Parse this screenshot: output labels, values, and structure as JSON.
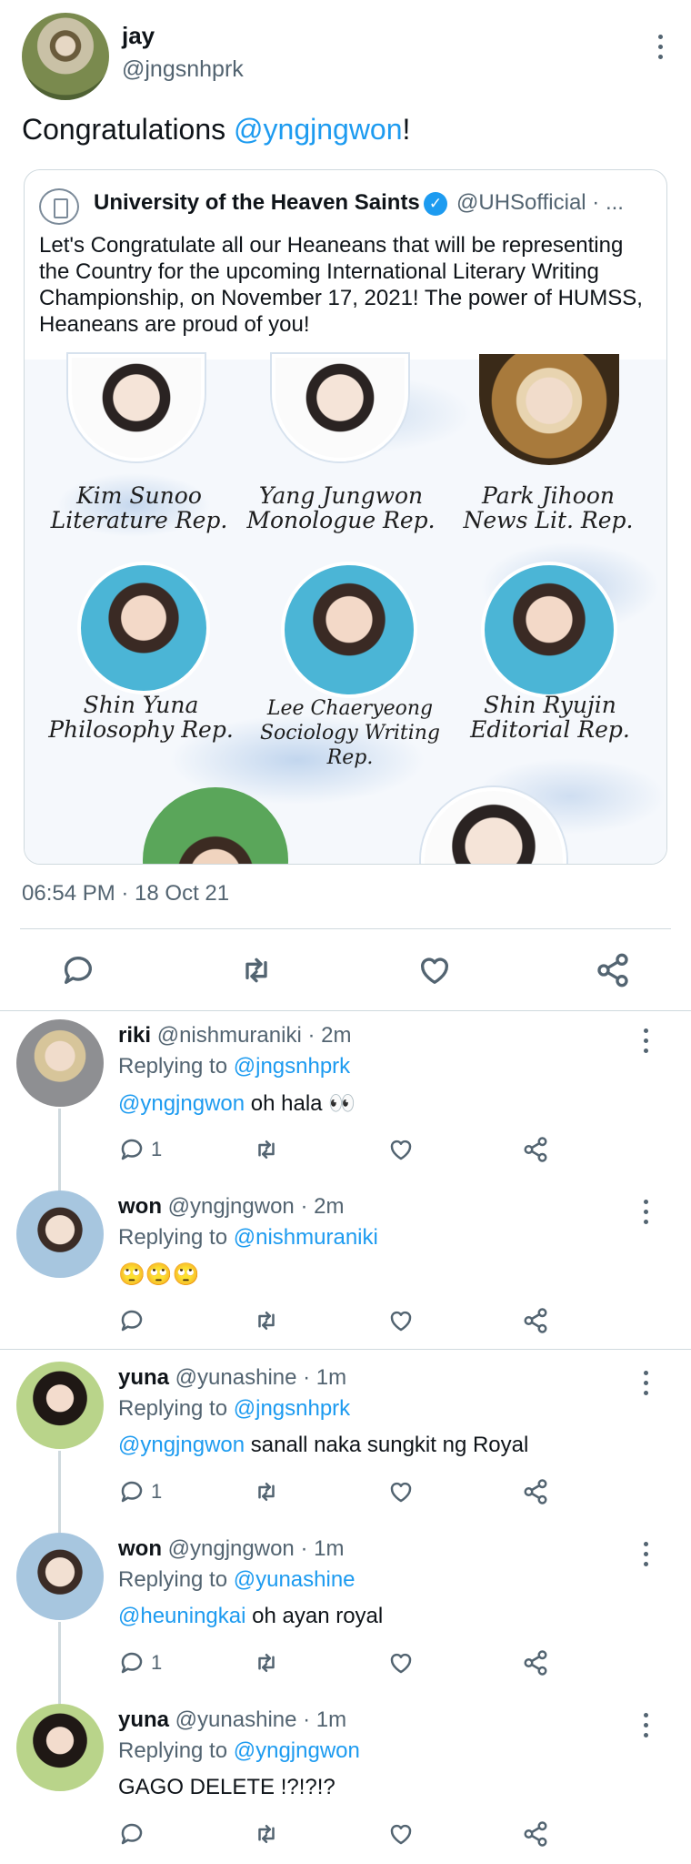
{
  "tweet": {
    "name": "jay",
    "handle": "@jngsnhprk",
    "text_prefix": "Congratulations ",
    "mention": "@yngjngwon",
    "text_suffix": "!",
    "timestamp": "06:54 PM · 18 Oct 21"
  },
  "quote": {
    "name": "University of the Heaven Saints",
    "handle": "@UHSofficial · ...",
    "text": "Let's Congratulate all our Heaneans that will be representing the Country for the upcoming International Literary Writing Championship, on November 17, 2021! The power of HUMSS, Heaneans are proud of you!",
    "captions": [
      {
        "name": "Kim Sunoo",
        "role": "Literature Rep."
      },
      {
        "name": "Yang Jungwon",
        "role": "Monologue Rep."
      },
      {
        "name": "Park Jihoon",
        "role": "News Lit. Rep."
      },
      {
        "name": "Shin Yuna",
        "role": "Philosophy Rep."
      },
      {
        "name": "Lee Chaeryeong",
        "role": "Sociology Writing Rep."
      },
      {
        "name": "Shin Ryujin",
        "role": "Editorial Rep."
      }
    ]
  },
  "replies": [
    {
      "name": "riki",
      "meta": " @nishmuraniki · 2m",
      "replying_label": "Replying to ",
      "replying_to": "@jngsnhprk",
      "mention": "@yngjngwon",
      "text": " oh hala 👀",
      "reply_count": "1"
    },
    {
      "name": "won",
      "meta": " @yngjngwon · 2m",
      "replying_label": "Replying to ",
      "replying_to": "@nishmuraniki",
      "mention": "",
      "text": "🙄🙄🙄",
      "reply_count": ""
    },
    {
      "name": "yuna",
      "meta": " @yunashine · 1m",
      "replying_label": "Replying to ",
      "replying_to": "@jngsnhprk",
      "mention": "@yngjngwon",
      "text": " sanall naka sungkit ng Royal",
      "reply_count": "1"
    },
    {
      "name": "won",
      "meta": " @yngjngwon · 1m",
      "replying_label": "Replying to ",
      "replying_to": "@yunashine",
      "mention": "@heuningkai",
      "text": " oh ayan royal",
      "reply_count": "1"
    },
    {
      "name": "yuna",
      "meta": " @yunashine · 1m",
      "replying_label": "Replying to ",
      "replying_to": "@yngjngwon",
      "mention": "",
      "text": "GAGO DELETE !?!?!?",
      "reply_count": ""
    }
  ],
  "icons": {
    "reply": "reply-icon",
    "retweet": "retweet-icon",
    "like": "heart-icon",
    "share": "share-icon",
    "more": "more-vertical-icon",
    "verified": "verified-badge-icon"
  },
  "colors": {
    "accent": "#1d9bf0",
    "muted": "#536471",
    "text": "#0f1419",
    "border": "#cfd9de"
  }
}
